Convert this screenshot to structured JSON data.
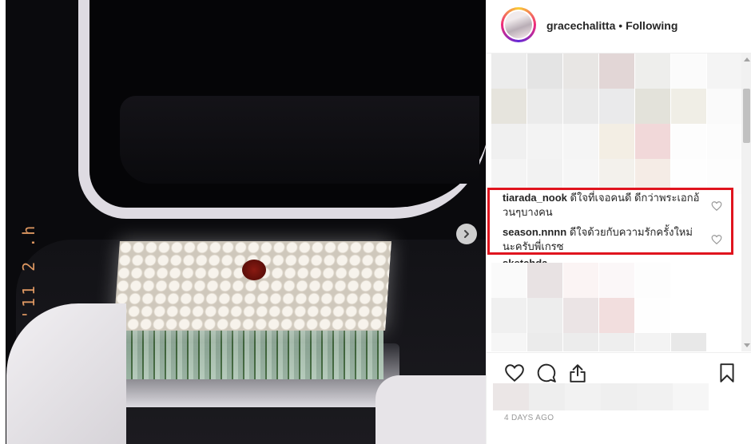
{
  "photo": {
    "stamp_text": "'11 2 .h"
  },
  "header": {
    "username": "gracechalitta",
    "separator": "•",
    "follow_status": "Following"
  },
  "comments": [
    {
      "user": "tiarada_nook",
      "text": "ดีใจที่เจอคนดี ดีกว่าพระเอกอ้วนๆบางคน"
    },
    {
      "user": "season.nnnn",
      "text": "ดีใจด้วยกับความรักครั้งใหม่นะครับพี่เกรซ"
    },
    {
      "user": "sketchda",
      "text": ""
    }
  ],
  "post": {
    "date": "4 DAYS AGO"
  },
  "colors": {
    "highlight_border": "#e0141e",
    "text": "#262626",
    "muted": "#999999"
  },
  "icons": [
    "chevron-right-icon",
    "heart-icon",
    "comment-icon",
    "share-icon",
    "bookmark-icon"
  ]
}
